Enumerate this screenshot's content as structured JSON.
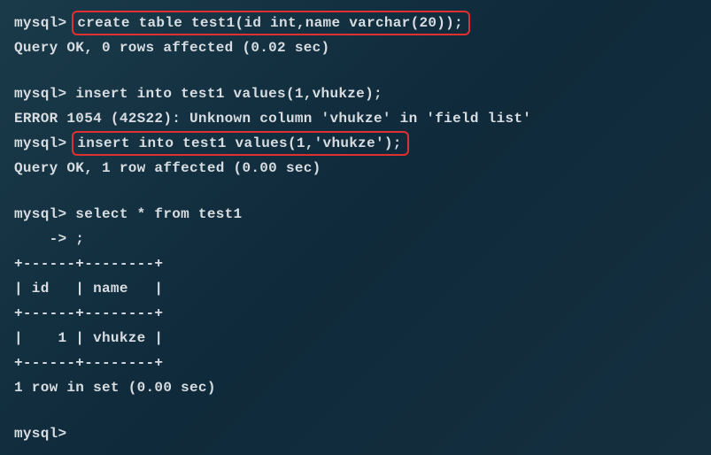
{
  "terminal": {
    "lines": {
      "l1_prompt": "mysql> ",
      "l1_cmd": "create table test1(id int,name varchar(20));",
      "l2": "Query OK, 0 rows affected (0.02 sec)",
      "l3_prompt": "mysql> ",
      "l3_cmd": "insert into test1 values(1,vhukze);",
      "l4": "ERROR 1054 (42S22): Unknown column 'vhukze' in 'field list'",
      "l5_prompt": "mysql> ",
      "l5_cmd": "insert into test1 values(1,'vhukze');",
      "l6": "Query OK, 1 row affected (0.00 sec)",
      "l7": "mysql> select * from test1",
      "l8": "    -> ;",
      "l9": "+------+--------+",
      "l10": "| id   | name   |",
      "l11": "+------+--------+",
      "l12": "|    1 | vhukze |",
      "l13": "+------+--------+",
      "l14": "1 row in set (0.00 sec)",
      "l15": "mysql>"
    }
  }
}
